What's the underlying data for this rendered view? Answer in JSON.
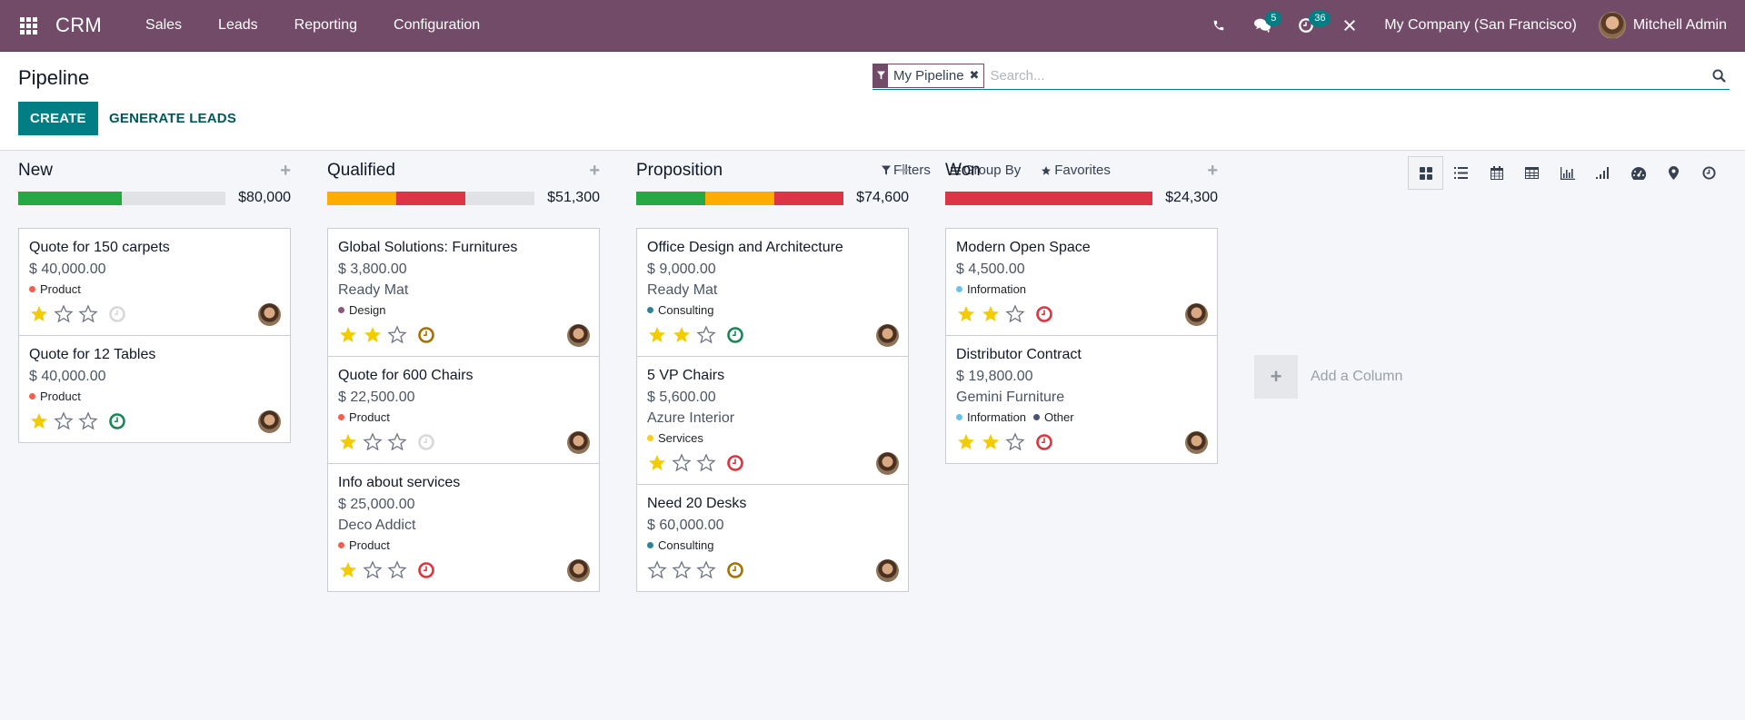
{
  "navbar": {
    "app_name": "CRM",
    "menu": [
      "Sales",
      "Leads",
      "Reporting",
      "Configuration"
    ],
    "icons": [
      "phone-icon",
      "chat-icon",
      "activity-clock-icon",
      "tools-icon"
    ],
    "messages_badge": "5",
    "activities_badge": "36",
    "company": "My Company (San Francisco)",
    "user": "Mitchell Admin",
    "bg_color": "#714b67"
  },
  "control": {
    "title": "Pipeline",
    "create_label": "CREATE",
    "generate_label": "GENERATE LEADS",
    "facet_label": "My Pipeline",
    "search_placeholder": "Search...",
    "filters_label": "Filters",
    "groupby_label": "Group By",
    "favorites_label": "Favorites",
    "views": [
      "kanban",
      "list",
      "calendar",
      "pivot",
      "graph",
      "cohort",
      "dashboard",
      "map",
      "activity"
    ],
    "active_view": "kanban",
    "accent_color": "#017e84"
  },
  "columns": [
    {
      "title": "New",
      "total": "$80,000",
      "progress": [
        {
          "color": "#28a745",
          "fraction": 0.5
        }
      ],
      "cards": [
        {
          "title": "Quote for 150 carpets",
          "amount": "$ 40,000.00",
          "partner": "",
          "tags": [
            {
              "label": "Product",
              "color": "#f06050"
            }
          ],
          "stars": 1,
          "activity": "none"
        },
        {
          "title": "Quote for 12 Tables",
          "amount": "$ 40,000.00",
          "partner": "",
          "tags": [
            {
              "label": "Product",
              "color": "#f06050"
            }
          ],
          "stars": 1,
          "activity": "planned"
        }
      ]
    },
    {
      "title": "Qualified",
      "total": "$51,300",
      "progress": [
        {
          "color": "#ffac00",
          "fraction": 0.3333
        },
        {
          "color": "#dc3545",
          "fraction": 0.3333
        }
      ],
      "cards": [
        {
          "title": "Global Solutions: Furnitures",
          "amount": "$ 3,800.00",
          "partner": "Ready Mat",
          "tags": [
            {
              "label": "Design",
              "color": "#875a7b"
            }
          ],
          "stars": 2,
          "activity": "today"
        },
        {
          "title": "Quote for 600 Chairs",
          "amount": "$ 22,500.00",
          "partner": "",
          "tags": [
            {
              "label": "Product",
              "color": "#f06050"
            }
          ],
          "stars": 1,
          "activity": "none"
        },
        {
          "title": "Info about services",
          "amount": "$ 25,000.00",
          "partner": "Deco Addict",
          "tags": [
            {
              "label": "Product",
              "color": "#f06050"
            }
          ],
          "stars": 1,
          "activity": "overdue"
        }
      ]
    },
    {
      "title": "Proposition",
      "total": "$74,600",
      "progress": [
        {
          "color": "#28a745",
          "fraction": 0.3333
        },
        {
          "color": "#ffac00",
          "fraction": 0.3333
        },
        {
          "color": "#dc3545",
          "fraction": 0.3334
        }
      ],
      "cards": [
        {
          "title": "Office Design and Architecture",
          "amount": "$ 9,000.00",
          "partner": "Ready Mat",
          "tags": [
            {
              "label": "Consulting",
              "color": "#2c8397"
            }
          ],
          "stars": 2,
          "activity": "planned"
        },
        {
          "title": "5 VP Chairs",
          "amount": "$ 5,600.00",
          "partner": "Azure Interior",
          "tags": [
            {
              "label": "Services",
              "color": "#f7cd1f"
            }
          ],
          "stars": 1,
          "activity": "overdue"
        },
        {
          "title": "Need 20 Desks",
          "amount": "$ 60,000.00",
          "partner": "",
          "tags": [
            {
              "label": "Consulting",
              "color": "#2c8397"
            }
          ],
          "stars": 0,
          "activity": "today"
        }
      ]
    },
    {
      "title": "Won",
      "total": "$24,300",
      "progress": [
        {
          "color": "#dc3545",
          "fraction": 1.0
        }
      ],
      "cards": [
        {
          "title": "Modern Open Space",
          "amount": "$ 4,500.00",
          "partner": "",
          "tags": [
            {
              "label": "Information",
              "color": "#6cc1ed"
            }
          ],
          "stars": 2,
          "activity": "overdue"
        },
        {
          "title": "Distributor Contract",
          "amount": "$ 19,800.00",
          "partner": "Gemini Furniture",
          "tags": [
            {
              "label": "Information",
              "color": "#6cc1ed"
            },
            {
              "label": "Other",
              "color": "#475577"
            }
          ],
          "stars": 2,
          "activity": "overdue"
        }
      ]
    }
  ],
  "add_column_label": "Add a Column",
  "activity_colors": {
    "none": "#d8d8d8",
    "planned": "#198754",
    "today": "#a67100",
    "overdue": "#d9363e"
  },
  "star_color": "#f3cc00"
}
